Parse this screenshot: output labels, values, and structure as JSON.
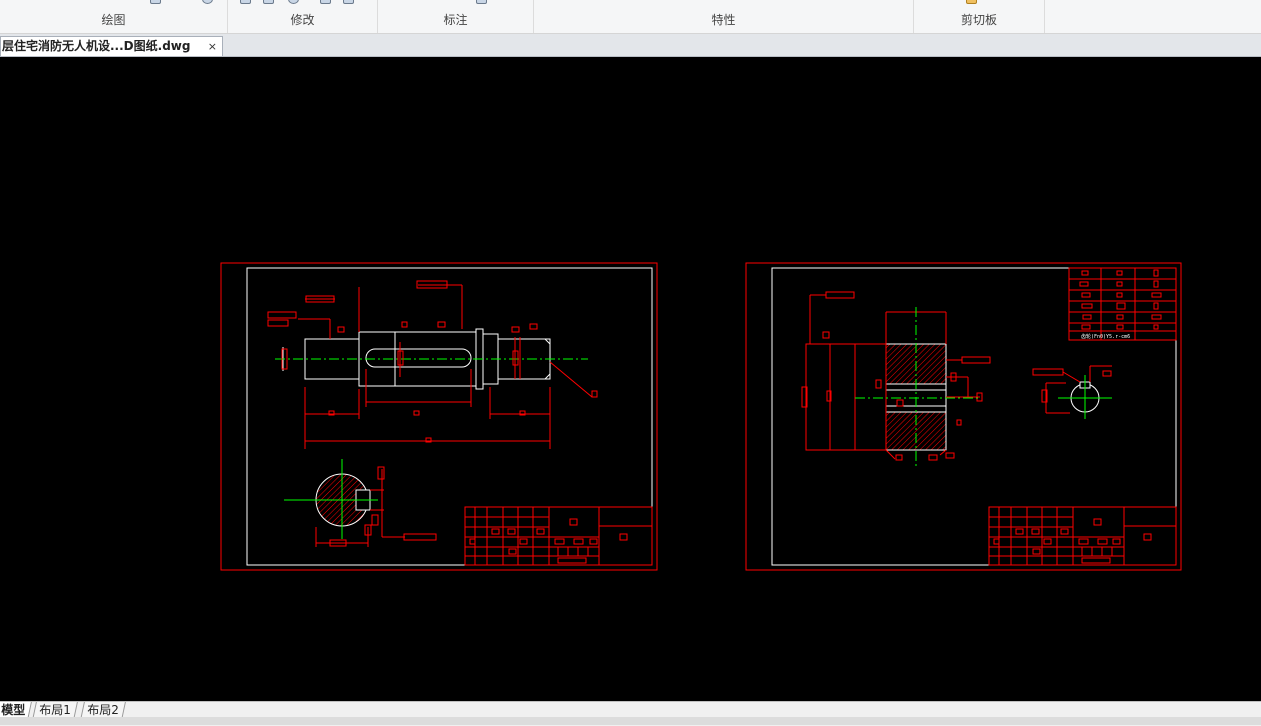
{
  "ribbon": {
    "groups": [
      {
        "label": "绘图"
      },
      {
        "label": "修改"
      },
      {
        "label": "标注"
      },
      {
        "label": "特性"
      },
      {
        "label": "剪切板"
      }
    ]
  },
  "document": {
    "tab_title": "层住宅消防无人机设...D图纸.dwg",
    "close_symbol": "×"
  },
  "drawing": {
    "title_label": "齿轮(Fn0)Y5.r-cm6"
  },
  "layout_tabs": [
    {
      "label": "模型",
      "active": true
    },
    {
      "label": "布局1",
      "active": false
    },
    {
      "label": "布局2",
      "active": false
    }
  ],
  "colors": {
    "canvas_background": "#000000",
    "frame_red": "#ff0000",
    "geometry_white": "#ffffff",
    "centerline_green": "#00ff00"
  }
}
